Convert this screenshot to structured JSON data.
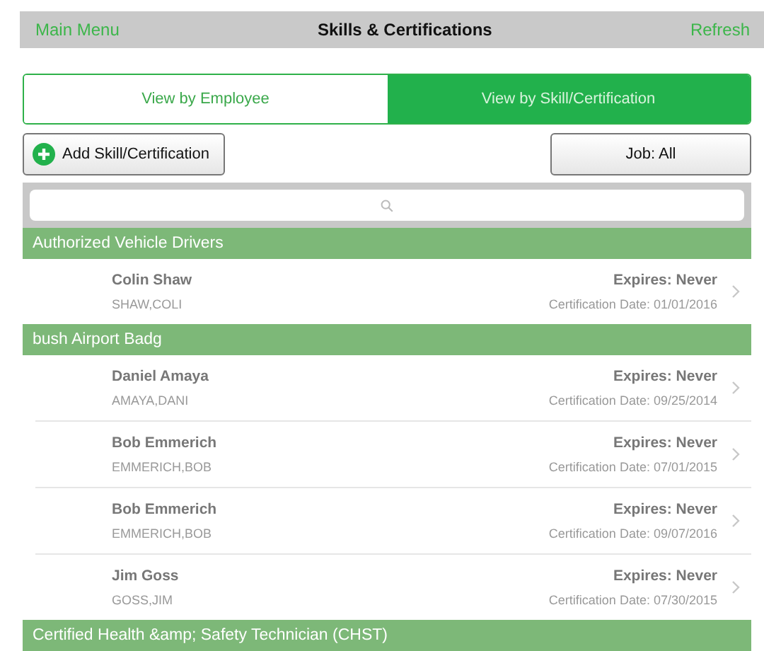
{
  "nav_bar": {
    "left_link": "Main Menu",
    "title": "Skills & Certifications",
    "right_link": "Refresh"
  },
  "tabs": [
    {
      "label": "View by Employee",
      "selected": false
    },
    {
      "label": "View by Skill/Certification",
      "selected": true
    }
  ],
  "add_button": {
    "label": "Add Skill/Certification"
  },
  "job_button": {
    "label": "Job: All"
  },
  "sections": [
    {
      "title": "Authorized Vehicle Drivers",
      "rows": [
        {
          "name": "Colin Shaw",
          "code": "SHAW,COLI",
          "expires": "Expires: Never",
          "date": "Certification Date: 01/01/2016"
        }
      ]
    },
    {
      "title": "bush Airport  Badg",
      "rows": [
        {
          "name": "Daniel Amaya",
          "code": "AMAYA,DANI",
          "expires": "Expires: Never",
          "date": "Certification Date: 09/25/2014"
        },
        {
          "name": "Bob Emmerich",
          "code": "EMMERICH,BOB",
          "expires": "Expires: Never",
          "date": "Certification Date: 07/01/2015"
        },
        {
          "name": "Bob Emmerich",
          "code": "EMMERICH,BOB",
          "expires": "Expires: Never",
          "date": "Certification Date: 09/07/2016"
        },
        {
          "name": "Jim Goss",
          "code": "GOSS,JIM",
          "expires": "Expires: Never",
          "date": "Certification Date: 07/30/2015"
        }
      ]
    },
    {
      "title": "Certified Health &amp; Safety Technician (CHST)"
    }
  ]
}
